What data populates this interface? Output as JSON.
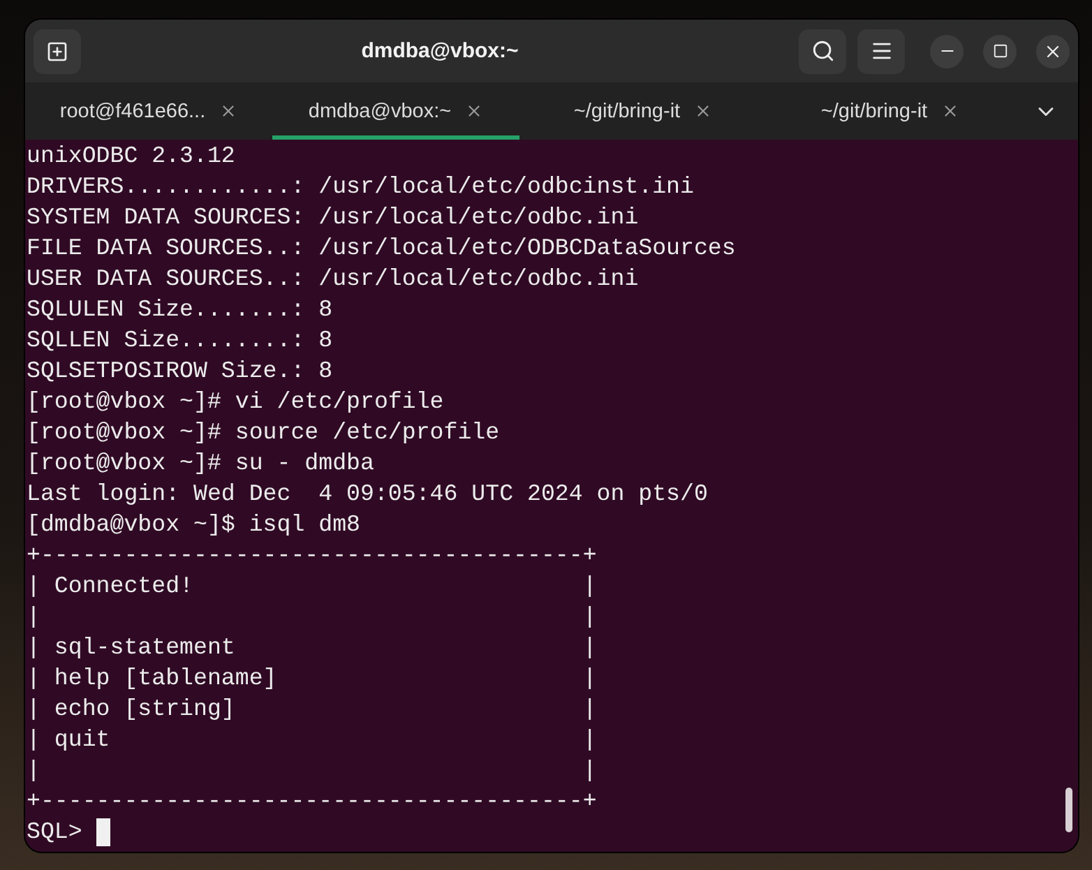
{
  "window": {
    "title": "dmdba@vbox:~"
  },
  "tabs": [
    {
      "label": "root@f461e66...",
      "selected": false
    },
    {
      "label": "dmdba@vbox:~",
      "selected": true
    },
    {
      "label": "~/git/bring-it",
      "selected": false
    },
    {
      "label": "~/git/bring-it",
      "selected": false
    }
  ],
  "terminal": {
    "lines": [
      "unixODBC 2.3.12",
      "DRIVERS............: /usr/local/etc/odbcinst.ini",
      "SYSTEM DATA SOURCES: /usr/local/etc/odbc.ini",
      "FILE DATA SOURCES..: /usr/local/etc/ODBCDataSources",
      "USER DATA SOURCES..: /usr/local/etc/odbc.ini",
      "SQLULEN Size.......: 8",
      "SQLLEN Size........: 8",
      "SQLSETPOSIROW Size.: 8",
      "[root@vbox ~]# vi /etc/profile",
      "[root@vbox ~]# source /etc/profile",
      "[root@vbox ~]# su - dmdba",
      "Last login: Wed Dec  4 09:05:46 UTC 2024 on pts/0",
      "[dmdba@vbox ~]$ isql dm8",
      "+---------------------------------------+",
      "| Connected!                            |",
      "|                                       |",
      "| sql-statement                         |",
      "| help [tablename]                      |",
      "| echo [string]                         |",
      "| quit                                  |",
      "|                                       |",
      "+---------------------------------------+"
    ],
    "prompt": "SQL>"
  }
}
